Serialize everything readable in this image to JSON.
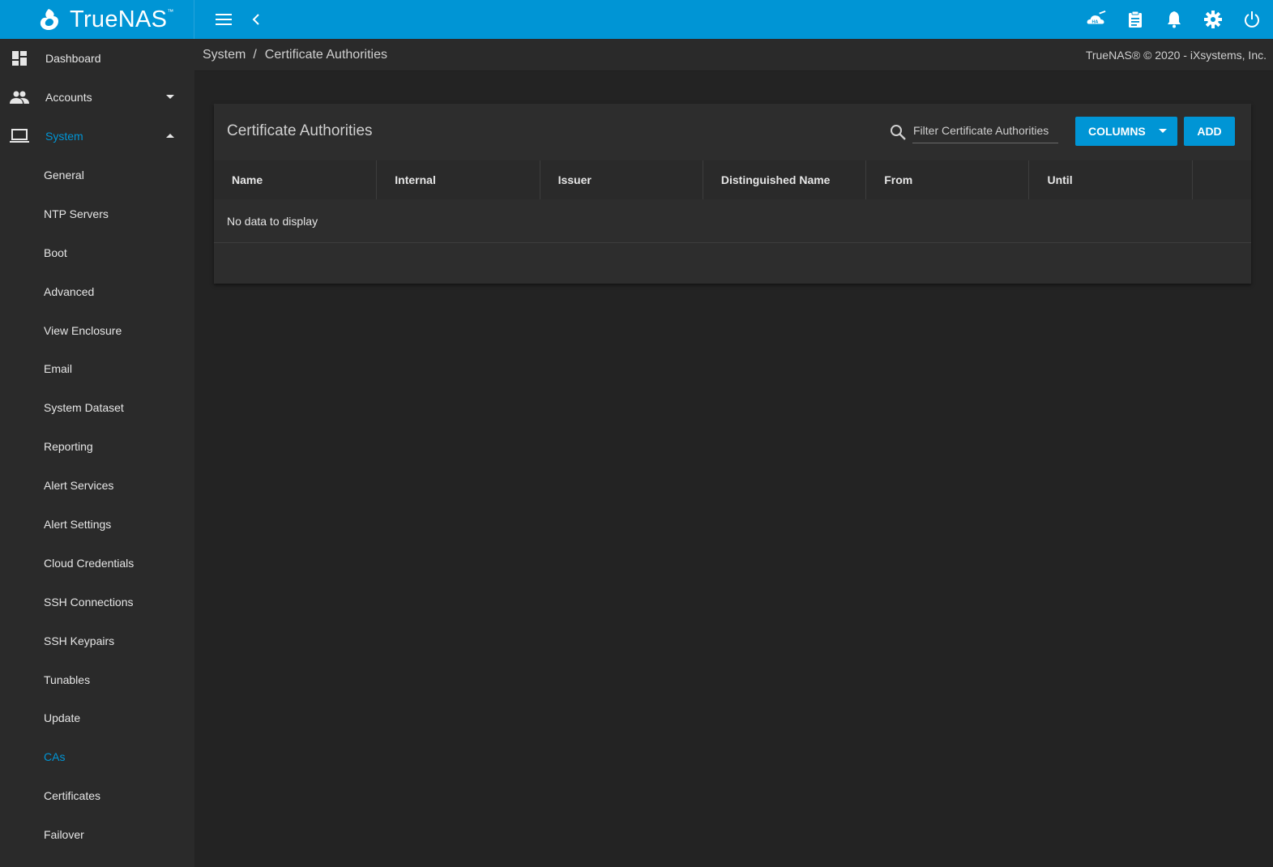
{
  "brand": {
    "name": "TrueNAS",
    "tm": "™"
  },
  "colors": {
    "accent": "#0095d5",
    "topbar": "#0095d5",
    "bg": "#232323",
    "sidebar": "#2a2a2a",
    "card": "#2d2d2d"
  },
  "topbar": {
    "left_icons": [
      "menu-icon",
      "chevron-left-icon"
    ],
    "right_icons": [
      "ha-status-icon",
      "task-manager-icon",
      "notifications-bell-icon",
      "settings-gear-icon",
      "power-icon"
    ]
  },
  "sidebar": {
    "items": [
      {
        "label": "Dashboard",
        "icon": "dashboard-icon"
      },
      {
        "label": "Accounts",
        "icon": "people-icon",
        "expanded": false
      },
      {
        "label": "System",
        "icon": "laptop-icon",
        "expanded": true,
        "active": true
      }
    ],
    "system_children": [
      "General",
      "NTP Servers",
      "Boot",
      "Advanced",
      "View Enclosure",
      "Email",
      "System Dataset",
      "Reporting",
      "Alert Services",
      "Alert Settings",
      "Cloud Credentials",
      "SSH Connections",
      "SSH Keypairs",
      "Tunables",
      "Update",
      "CAs",
      "Certificates",
      "Failover"
    ],
    "active_child": "CAs"
  },
  "breadcrumb": {
    "root": "System",
    "separator": "/",
    "current": "Certificate Authorities"
  },
  "copyright": "TrueNAS® © 2020 - iXsystems, Inc.",
  "card": {
    "title": "Certificate Authorities",
    "filter_placeholder": "Filter Certificate Authorities",
    "columns_label": "COLUMNS",
    "add_label": "ADD",
    "table_headers": [
      "Name",
      "Internal",
      "Issuer",
      "Distinguished Name",
      "From",
      "Until"
    ],
    "empty_message": "No data to display"
  }
}
